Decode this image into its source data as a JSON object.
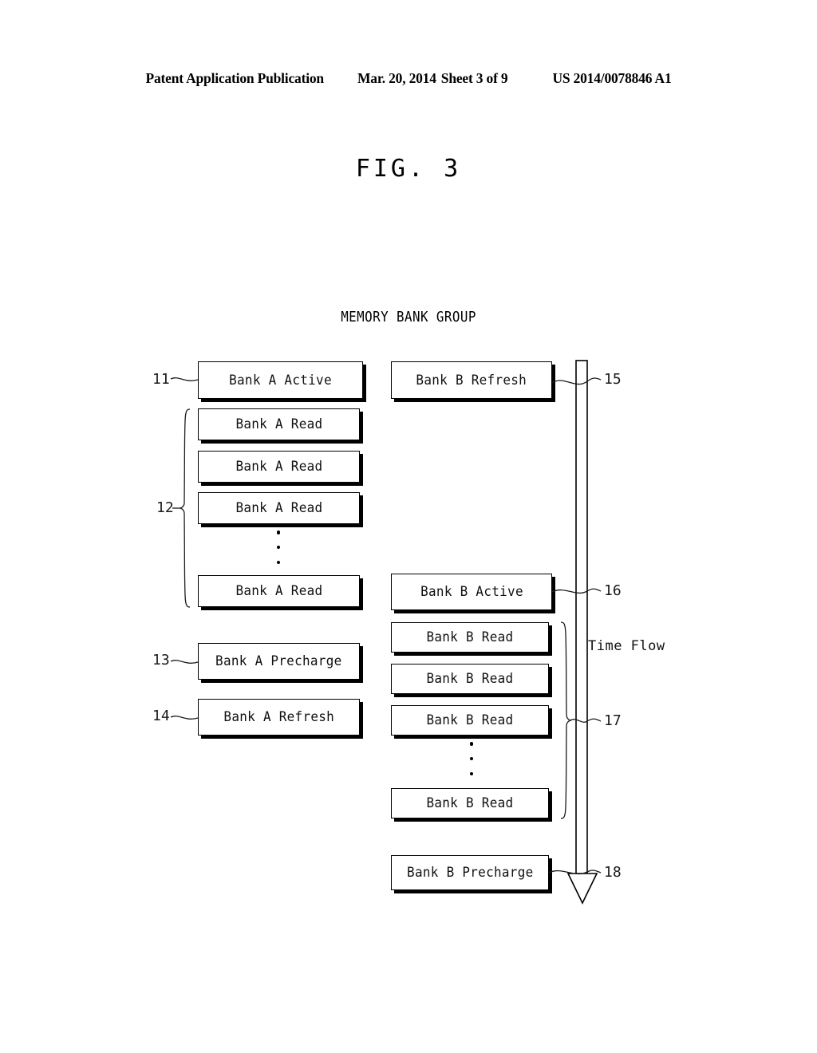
{
  "header": {
    "publication": "Patent Application Publication",
    "date": "Mar. 20, 2014",
    "sheet": "Sheet 3 of 9",
    "patent_number": "US 2014/0078846 A1"
  },
  "figure": {
    "title": "FIG. 3",
    "diagram_title": "MEMORY BANK GROUP",
    "time_flow_label": "Time Flow"
  },
  "bank_a": {
    "active": "Bank A Active",
    "read_1": "Bank A Read",
    "read_2": "Bank A Read",
    "read_3": "Bank A Read",
    "read_last": "Bank A Read",
    "precharge": "Bank A Precharge",
    "refresh": "Bank A Refresh"
  },
  "bank_b": {
    "refresh": "Bank B Refresh",
    "active": "Bank B Active",
    "read_1": "Bank B Read",
    "read_2": "Bank B Read",
    "read_3": "Bank B Read",
    "read_last": "Bank B Read",
    "precharge": "Bank B Precharge"
  },
  "refs": {
    "r11": "11",
    "r12": "12",
    "r13": "13",
    "r14": "14",
    "r15": "15",
    "r16": "16",
    "r17": "17",
    "r18": "18"
  }
}
